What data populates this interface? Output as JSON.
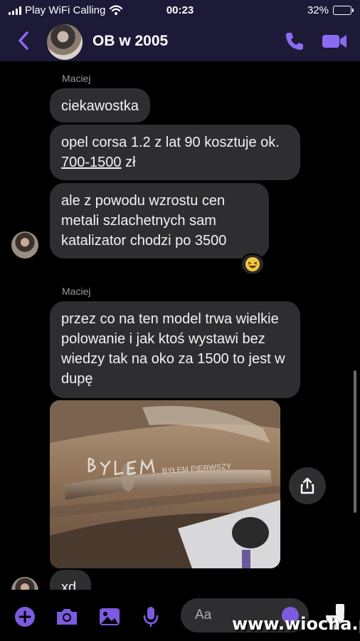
{
  "status_bar": {
    "carrier": "Play WiFi Calling",
    "time": "00:23",
    "battery": "32%",
    "battery_level": 0.32
  },
  "header": {
    "title": "OB w 2005",
    "back_icon": "chevron-left-icon",
    "call_icon": "phone-icon",
    "video_icon": "video-camera-icon"
  },
  "messages": [
    {
      "sender": "Maciej",
      "text": "ciekawostka"
    },
    {
      "text_before": "opel corsa 1.2 z lat 90 kosztuje ok. ",
      "text_link": "700-1500",
      "text_after": " zł"
    },
    {
      "text": "ale z powodu wzrostu cen metali szlachetnych sam katalizator chodzi po 3500",
      "reaction": "laughing-emoji"
    },
    {
      "sender": "Maciej",
      "text": "przez co na ten model trwa wielkie polowanie i jak ktoś wystawi bez wiedzy tak na oko za 1500 to jest w dupę"
    },
    {
      "photo_caption": "BYŁEM PIERWSZY"
    },
    {
      "text": "xd"
    }
  ],
  "composer": {
    "placeholder": "Aa",
    "icons": [
      "plus-icon",
      "camera-icon",
      "gallery-icon",
      "microphone-icon",
      "emoji-icon"
    ]
  },
  "watermark": "www.wiocha.pl",
  "colors": {
    "header_bg": "#1d1a38",
    "accent": "#7c5be0",
    "bubble": "#2e2e30"
  }
}
